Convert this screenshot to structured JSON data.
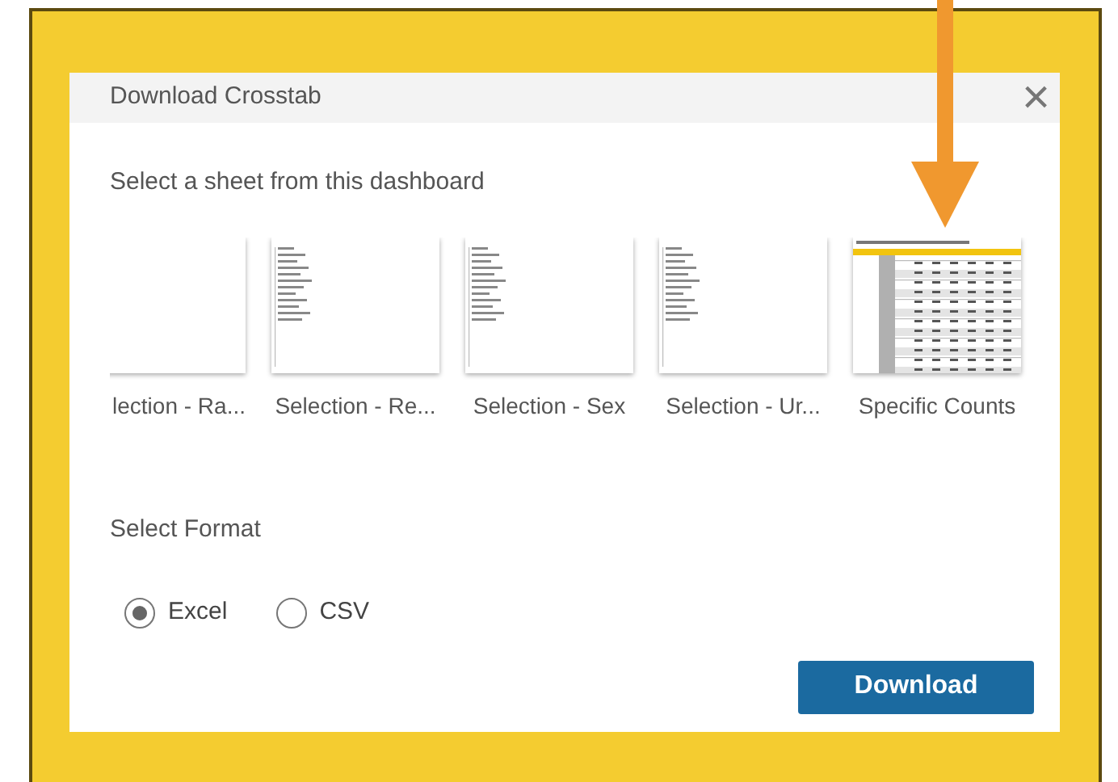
{
  "dialog": {
    "title": "Download Crosstab",
    "close": "×"
  },
  "sheet_prompt": "Select a sheet from this dashboard",
  "sheets": [
    {
      "label": "lection - Ra...",
      "kind": "blank",
      "selected": false
    },
    {
      "label": "Selection - Re...",
      "kind": "list",
      "selected": false
    },
    {
      "label": "Selection - Sex",
      "kind": "list",
      "selected": false
    },
    {
      "label": "Selection - Ur...",
      "kind": "list",
      "selected": false
    },
    {
      "label": "Specific Counts",
      "kind": "table",
      "selected": false
    }
  ],
  "format_prompt": "Select Format",
  "formats": [
    {
      "label": "Excel",
      "selected": true
    },
    {
      "label": "CSV",
      "selected": false
    }
  ],
  "download_button": "Download"
}
